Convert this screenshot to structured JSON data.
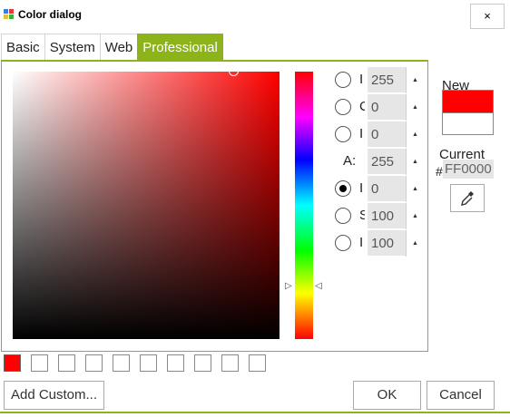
{
  "window": {
    "title": "Color dialog",
    "close_label": "×",
    "icon": "app-palette-icon"
  },
  "tabs": [
    {
      "label": "Basic",
      "active": false
    },
    {
      "label": "System",
      "active": false
    },
    {
      "label": "Web",
      "active": false
    },
    {
      "label": "Professional",
      "active": true
    }
  ],
  "colors": {
    "accent": "#8cb31a",
    "new_color": "#ff0000",
    "current_color": "#ffffff",
    "hue_base": "#ff0000"
  },
  "channels": [
    {
      "label": "I",
      "value": "255",
      "selected": false,
      "has_radio": true
    },
    {
      "label": "C",
      "value": "0",
      "selected": false,
      "has_radio": true
    },
    {
      "label": "I",
      "value": "0",
      "selected": false,
      "has_radio": true
    },
    {
      "label": "A:",
      "value": "255",
      "selected": false,
      "has_radio": false
    },
    {
      "label": "I",
      "value": "0",
      "selected": true,
      "has_radio": true
    },
    {
      "label": "S",
      "value": "100",
      "selected": false,
      "has_radio": true
    },
    {
      "label": "I",
      "value": "100",
      "selected": false,
      "has_radio": true
    }
  ],
  "preview": {
    "new_label": "New",
    "current_label": "Current",
    "hash": "#",
    "hex_value": "FF0000"
  },
  "custom_colors": {
    "filled": [
      "#ff0000"
    ],
    "empty_count": 9
  },
  "buttons": {
    "add_custom": "Add Custom...",
    "ok": "OK",
    "cancel": "Cancel"
  }
}
